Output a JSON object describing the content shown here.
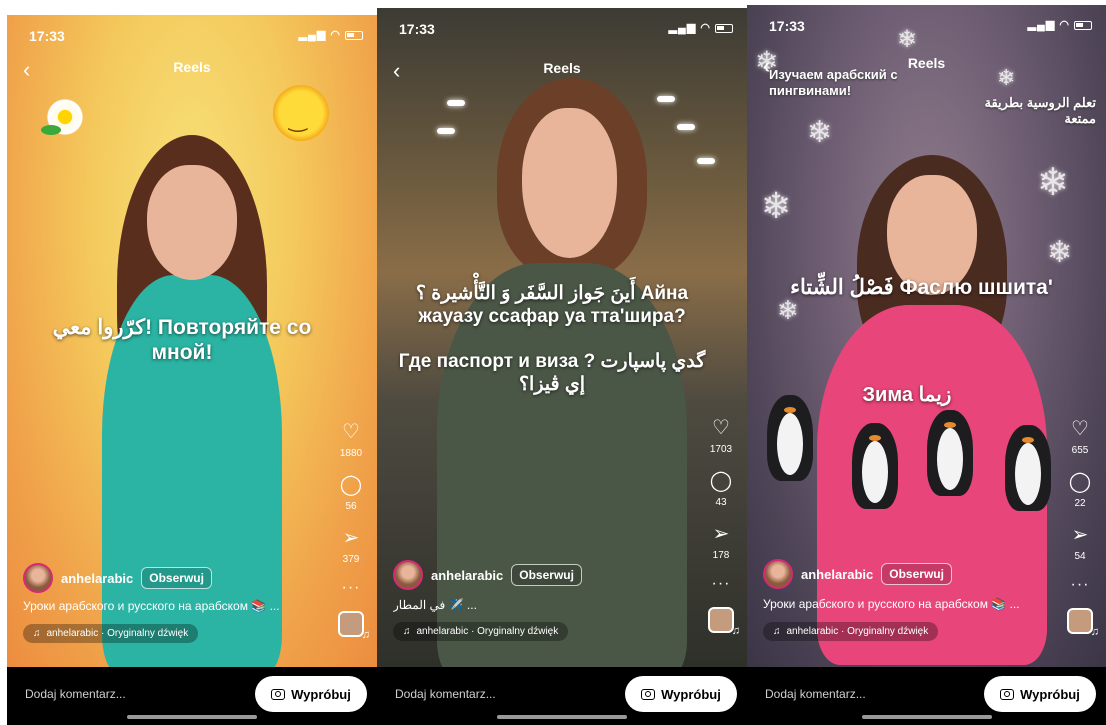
{
  "screens": [
    {
      "status": {
        "time": "17:33"
      },
      "header": {
        "title": "Reels"
      },
      "caption": "كرّروا معي! Повторяйте со мной!",
      "actions": {
        "likes": "1880",
        "comments": "56",
        "shares": "379"
      },
      "user": {
        "name": "anhelarabic",
        "follow_label": "Obserwuj"
      },
      "description": "Уроки арабского и русского на арабском 📚 ...",
      "audio": "anhelarabic · Oryginalny dźwięk",
      "bottom": {
        "comment_placeholder": "Dodaj komentarz...",
        "try_label": "Wypróbuj"
      }
    },
    {
      "status": {
        "time": "17:33"
      },
      "header": {
        "title": "Reels"
      },
      "caption": "أَينَ جَواز السَّفَر وَ التَّأْشيرة ؟ Айна жауазу ссафар уа тта'шира?\n\nГде паспорт и виза ? گدي پاسپارت إي ڤيزا؟",
      "actions": {
        "likes": "1703",
        "comments": "43",
        "shares": "178"
      },
      "user": {
        "name": "anhelarabic",
        "follow_label": "Obserwuj"
      },
      "description": "في المطار ✈️ ...",
      "audio": "anhelarabic · Oryginalny dźwięk",
      "bottom": {
        "comment_placeholder": "Dodaj komentarz...",
        "try_label": "Wypróbuj"
      }
    },
    {
      "status": {
        "time": "17:33"
      },
      "header": {
        "title": "Reels"
      },
      "promo_ru": "Изучаем арабский с пингвинами!",
      "promo_ar": "تعلم الروسية بطريقة ممتعة",
      "caption1": "فَصْلُ الشِّتاء Фаслю шшита'",
      "caption2": "Зима زيما",
      "actions": {
        "likes": "655",
        "comments": "22",
        "shares": "54"
      },
      "user": {
        "name": "anhelarabic",
        "follow_label": "Obserwuj"
      },
      "description": "Уроки арабского и русского на арабском 📚 ...",
      "audio": "anhelarabic · Oryginalny dźwięk",
      "bottom": {
        "comment_placeholder": "Dodaj komentarz...",
        "try_label": "Wypróbuj"
      }
    }
  ],
  "icons": {
    "back": "chevron-left-icon",
    "like": "heart-icon",
    "comment": "comment-bubble-icon",
    "share": "paper-plane-icon",
    "more": "more-dots-icon",
    "music": "music-note-icon",
    "camera": "camera-icon"
  },
  "colors": {
    "accent": "#d62976",
    "button_bg": "#ffffff",
    "bar_bg": "#000000"
  }
}
